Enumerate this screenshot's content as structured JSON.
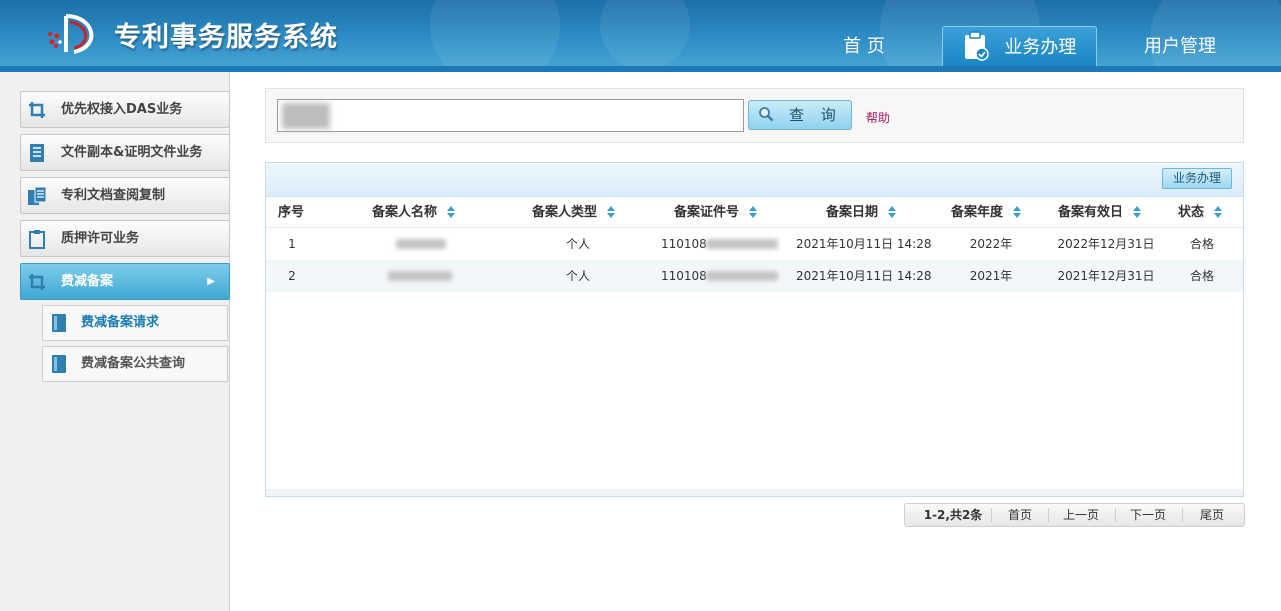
{
  "header": {
    "system_title": "专利事务服务系统",
    "nav": [
      {
        "label": "首 页"
      },
      {
        "label": "业务办理"
      },
      {
        "label": "用户管理"
      }
    ],
    "active_nav": "业务办理"
  },
  "sidebar": {
    "items": [
      {
        "label": "优先权接入DAS业务",
        "icon": "crop-icon"
      },
      {
        "label": "文件副本&证明文件业务",
        "icon": "document-list-icon"
      },
      {
        "label": "专利文档查阅复制",
        "icon": "copy-document-icon"
      },
      {
        "label": "质押许可业务",
        "icon": "clipboard-icon"
      },
      {
        "label": "费减备案",
        "icon": "crop-icon",
        "active": true
      }
    ],
    "sub_items": [
      {
        "label": "费减备案请求",
        "icon": "book-icon",
        "current": true
      },
      {
        "label": "费减备案公共查询",
        "icon": "book-icon"
      }
    ]
  },
  "search": {
    "value": "",
    "button_label": "查 询",
    "help_label": "帮助"
  },
  "grid": {
    "action_label": "业务办理",
    "columns": [
      "序号",
      "备案人名称",
      "备案人类型",
      "备案证件号",
      "备案日期",
      "备案年度",
      "备案有效日",
      "状态"
    ],
    "rows": [
      {
        "index": "1",
        "name": "",
        "type": "个人",
        "id_prefix": "110108",
        "date": "2021年10月11日 14:28",
        "year": "2022年",
        "valid_until": "2022年12月31日",
        "status": "合格"
      },
      {
        "index": "2",
        "name": "",
        "type": "个人",
        "id_prefix": "110108",
        "date": "2021年10月11日 14:28",
        "year": "2021年",
        "valid_until": "2021年12月31日",
        "status": "合格"
      }
    ]
  },
  "pager": {
    "summary": "1-2,共2条",
    "first": "首页",
    "prev": "上一页",
    "next": "下一页",
    "last": "尾页"
  },
  "colors": {
    "header_blue": "#2f8ec6",
    "active_blue": "#3fa9d6",
    "help_link": "#b3145c"
  }
}
